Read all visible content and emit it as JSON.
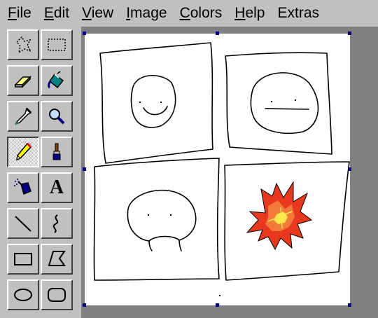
{
  "menu": {
    "items": [
      {
        "label": "File",
        "accel": "F",
        "rest": "ile"
      },
      {
        "label": "Edit",
        "accel": "E",
        "rest": "dit"
      },
      {
        "label": "View",
        "accel": "V",
        "rest": "iew"
      },
      {
        "label": "Image",
        "accel": "I",
        "rest": "mage"
      },
      {
        "label": "Colors",
        "accel": "C",
        "rest": "olors"
      },
      {
        "label": "Help",
        "accel": "H",
        "rest": "elp"
      },
      {
        "label": "Extras",
        "accel": "",
        "rest": "Extras"
      }
    ]
  },
  "toolbox": {
    "tools": [
      {
        "name": "free-form-select",
        "selected": false
      },
      {
        "name": "rectangle-select",
        "selected": false
      },
      {
        "name": "eraser",
        "selected": false
      },
      {
        "name": "fill-with-color",
        "selected": false
      },
      {
        "name": "pick-color",
        "selected": false
      },
      {
        "name": "magnifier",
        "selected": false
      },
      {
        "name": "pencil",
        "selected": true
      },
      {
        "name": "brush",
        "selected": false
      },
      {
        "name": "airbrush",
        "selected": false
      },
      {
        "name": "text",
        "selected": false
      },
      {
        "name": "line",
        "selected": false
      },
      {
        "name": "curve",
        "selected": false
      },
      {
        "name": "rectangle",
        "selected": false
      },
      {
        "name": "polygon",
        "selected": false
      },
      {
        "name": "ellipse",
        "selected": false
      },
      {
        "name": "rounded-rectangle",
        "selected": false
      }
    ],
    "text_tool_glyph": "A"
  },
  "colors": {
    "chrome": "#c0c0c0",
    "workspace": "#808080",
    "canvas": "#ffffff",
    "handle": "#000080",
    "explosion_outer": "#e8391f",
    "explosion_middle": "#f47a3c",
    "explosion_core": "#ffe84a"
  }
}
